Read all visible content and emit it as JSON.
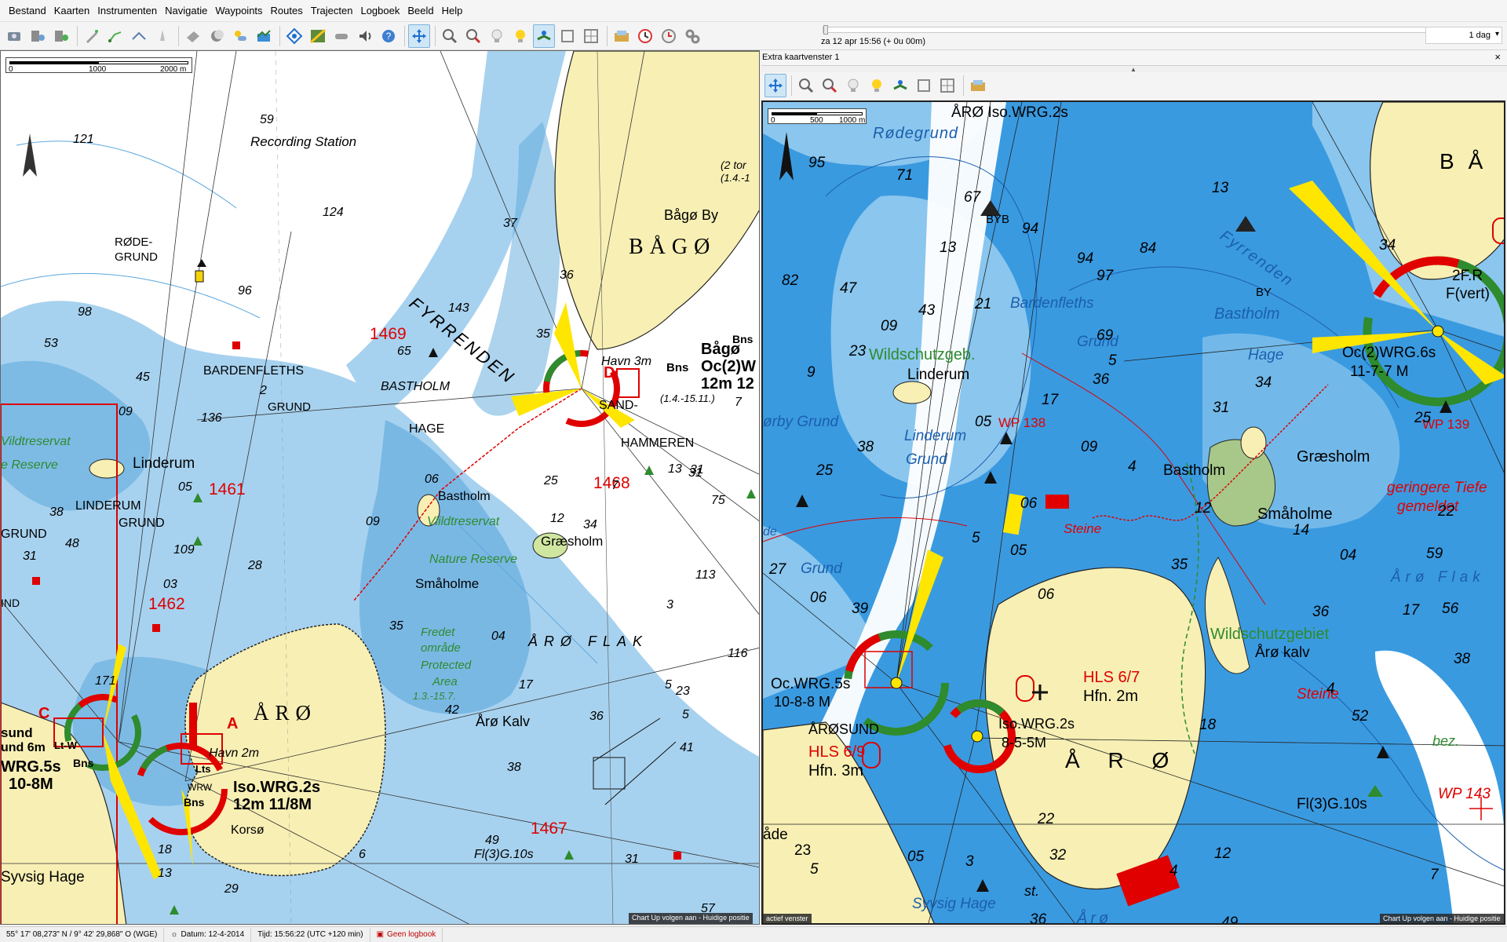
{
  "menu": [
    "Bestand",
    "Kaarten",
    "Instrumenten",
    "Navigatie",
    "Waypoints",
    "Routes",
    "Trajecten",
    "Logboek",
    "Beeld",
    "Help"
  ],
  "timebar": {
    "datetime": "za 12 apr 15:56  (+ 0u 00m)",
    "period": "1 dag"
  },
  "secondary_window": {
    "title": "Extra kaartvenster 1",
    "close": "×",
    "status": "actief venster"
  },
  "overlay": {
    "status": "Chart Up volgen aan - Huidige positie"
  },
  "left_chart": {
    "scale": {
      "zero": "0",
      "mid": "1000",
      "end": "2000 m"
    },
    "labels": [
      "Recording Station",
      "BÅGØ",
      "Bågø By",
      "FYRRENDEN",
      "RØDE-",
      "GRUND",
      "BARDENFLETHS",
      "GRUND",
      "BASTHOLM",
      "HAGE",
      "Linderum",
      "LINDERUM",
      "GRUND",
      "Vildtreservat",
      "e Reserve",
      "SAND-",
      "HAMMEREN",
      "Bastholm",
      "Viildtreservat",
      "Nature Reserve",
      "Græsholm",
      "Småholme",
      "ÅRØ FLAK",
      "ÅRØ",
      "Havn 2m",
      "Iso.WRG.2s",
      "12m 11/8M",
      "Korsø",
      "Årø Kalv",
      "Fredet",
      "område",
      "Protected",
      "Area",
      "1.3.-15.7.",
      "Syvsig Hage",
      "ÅRØ SAND",
      "Fl(3)G.10s",
      "sund",
      "und 6m",
      "WRG.5s",
      "10-8M",
      "Lt-W",
      "Bns",
      "Lts",
      "WRW",
      "Bns",
      "Havn 3m",
      "Bns",
      "Bågø",
      "Oc(2)W",
      "12m 12",
      "(1.4.-15.11.)",
      "(2 tor",
      "(1.4.-1",
      "Bns",
      "GRUND",
      "IND"
    ],
    "waypoints": [
      "1469",
      "1461",
      "1462",
      "1468",
      "1467"
    ],
    "route_letters": [
      "A",
      "C",
      "D"
    ],
    "soundings": [
      "121",
      "59",
      "124",
      "98",
      "96",
      "53",
      "45",
      "136",
      "2",
      "09",
      "38",
      "48",
      "31",
      "05",
      "109",
      "143",
      "65",
      "37",
      "35",
      "36",
      "31",
      "06",
      "25",
      "12",
      "09",
      "28",
      "34",
      "35",
      "04",
      "17",
      "42",
      "38",
      "3",
      "5",
      "7",
      "75",
      "31",
      "13",
      "113",
      "49",
      "31",
      "5",
      "116",
      "23",
      "29",
      "18",
      "13",
      "6",
      "7",
      "36",
      "41",
      "57",
      "171",
      "03"
    ]
  },
  "right_chart": {
    "scale": {
      "zero": "0",
      "mid": "500",
      "end": "1000 m"
    },
    "labels": [
      "ÅRØ Iso.WRG.2s",
      "Rødegrund",
      "BYB",
      "Bardenfleths",
      "Grund",
      "Fyrrenden",
      "Bastholm",
      "Hage",
      "BY",
      "Wildschutzgeb.",
      "Linderum",
      "Linderum",
      "Grund",
      "WP 138",
      "Bastholm",
      "Græsholm",
      "Småholme",
      "geringere Tiefe",
      "gemeldet",
      "Steine",
      "Wildschutzgebiet",
      "Årø kalv",
      "Steine",
      "HLS 6/7",
      "Hfn. 2m",
      "Iso.WRG.2s",
      "8-5-5M",
      "Å R Ø",
      "Oc.WRG.5s",
      "10-8-8 M",
      "ÅRØSUND",
      "HLS 6/9",
      "Hfn. 3m",
      "Fl(3)G.10s",
      "WP 143",
      "Syvsig Hage",
      "Årø",
      "st.",
      "Grund",
      "ørby Grund",
      "2F.R",
      "F(vert)",
      "Oc(2)WRG.6s",
      "11-7-7 M",
      "WP 139",
      "BÅ",
      "Årø Flak",
      "bez.",
      "åde",
      "23",
      "de"
    ],
    "soundings": [
      "95",
      "71",
      "67",
      "13",
      "13",
      "94",
      "94",
      "97",
      "84",
      "34",
      "82",
      "47",
      "09",
      "43",
      "21",
      "69",
      "5",
      "23",
      "9",
      "17",
      "36",
      "31",
      "34",
      "25",
      "05",
      "38",
      "25",
      "4",
      "09",
      "12",
      "22",
      "59",
      "5",
      "06",
      "05",
      "35",
      "04",
      "14",
      "27",
      "06",
      "39",
      "06",
      "17",
      "36",
      "38",
      "56",
      "52",
      "4",
      "18",
      "5",
      "05",
      "3",
      "32",
      "4",
      "12",
      "22",
      "36",
      "49",
      "7"
    ]
  },
  "statusbar": {
    "position": "55° 17' 08,273\" N / 9° 42' 29,868\" O (WGE)",
    "date": "Datum: 12-4-2014",
    "time": "Tijd: 15:56:22 (UTC +120 min)",
    "log": "Geen logbook"
  },
  "colors": {
    "land": "#f7efb4",
    "shallow": "#5ba7dc",
    "mid": "#a7d2ef",
    "deep": "#ffffff",
    "route": "#e00000"
  }
}
